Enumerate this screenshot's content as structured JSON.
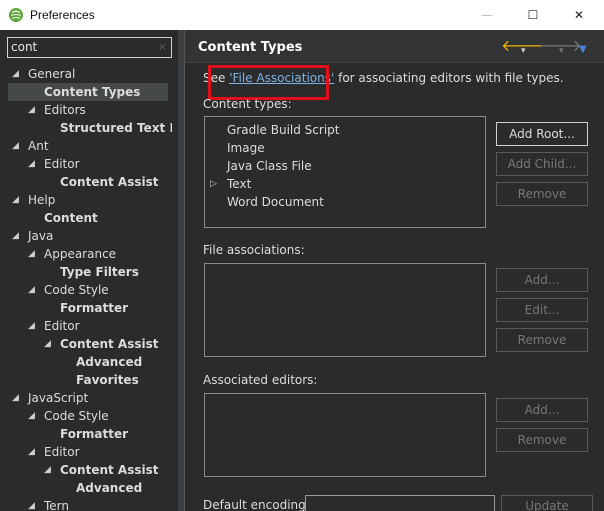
{
  "window": {
    "title": "Preferences",
    "controls": {
      "minimize": "—",
      "maximize": "☐",
      "close": "✕"
    }
  },
  "filter": {
    "value": "cont",
    "clear_icon": "✕"
  },
  "tree": [
    {
      "label": "General",
      "depth": 0,
      "bold": false,
      "expanded": true
    },
    {
      "label": "Content Types",
      "depth": 1,
      "bold": true,
      "selected": true
    },
    {
      "label": "Editors",
      "depth": 1,
      "bold": false,
      "expanded": true
    },
    {
      "label": "Structured Text Ed",
      "depth": 2,
      "bold": true
    },
    {
      "label": "Ant",
      "depth": 0,
      "bold": false,
      "expanded": true
    },
    {
      "label": "Editor",
      "depth": 1,
      "bold": false,
      "expanded": true
    },
    {
      "label": "Content Assist",
      "depth": 2,
      "bold": true
    },
    {
      "label": "Help",
      "depth": 0,
      "bold": false,
      "expanded": true
    },
    {
      "label": "Content",
      "depth": 1,
      "bold": true
    },
    {
      "label": "Java",
      "depth": 0,
      "bold": false,
      "expanded": true
    },
    {
      "label": "Appearance",
      "depth": 1,
      "bold": false,
      "expanded": true
    },
    {
      "label": "Type Filters",
      "depth": 2,
      "bold": true
    },
    {
      "label": "Code Style",
      "depth": 1,
      "bold": false,
      "expanded": true
    },
    {
      "label": "Formatter",
      "depth": 2,
      "bold": true
    },
    {
      "label": "Editor",
      "depth": 1,
      "bold": false,
      "expanded": true
    },
    {
      "label": "Content Assist",
      "depth": 2,
      "bold": true,
      "expanded": true
    },
    {
      "label": "Advanced",
      "depth": 3,
      "bold": true
    },
    {
      "label": "Favorites",
      "depth": 3,
      "bold": true
    },
    {
      "label": "JavaScript",
      "depth": 0,
      "bold": false,
      "expanded": true
    },
    {
      "label": "Code Style",
      "depth": 1,
      "bold": false,
      "expanded": true
    },
    {
      "label": "Formatter",
      "depth": 2,
      "bold": true
    },
    {
      "label": "Editor",
      "depth": 1,
      "bold": false,
      "expanded": true
    },
    {
      "label": "Content Assist",
      "depth": 2,
      "bold": true,
      "expanded": true
    },
    {
      "label": "Advanced",
      "depth": 3,
      "bold": true
    },
    {
      "label": "Tern",
      "depth": 1,
      "bold": false,
      "expanded": true
    }
  ],
  "page": {
    "title": "Content Types",
    "nav": {
      "back_icon": "🡐",
      "forward_icon": "🡒",
      "dropdown_icon": "▾",
      "menu_icon": "▼"
    },
    "description": {
      "prefix": "See ",
      "link": "'File Associations'",
      "suffix": " for associating editors with file types."
    },
    "content_types_label": "Content types:",
    "content_types": [
      {
        "label": "Gradle Build Script",
        "has_children": false
      },
      {
        "label": "Image",
        "has_children": false
      },
      {
        "label": "Java Class File",
        "has_children": false
      },
      {
        "label": "Text",
        "has_children": true
      },
      {
        "label": "Word Document",
        "has_children": false
      }
    ],
    "content_type_buttons": {
      "add_root": "Add Root...",
      "add_child": "Add Child...",
      "remove": "Remove"
    },
    "file_associations_label": "File associations:",
    "file_association_buttons": {
      "add": "Add...",
      "edit": "Edit...",
      "remove": "Remove"
    },
    "associated_editors_label": "Associated editors:",
    "associated_editor_buttons": {
      "add": "Add...",
      "remove": "Remove"
    },
    "default_encoding_label": "Default encoding:",
    "default_encoding_value": "",
    "update_button": "Update"
  }
}
